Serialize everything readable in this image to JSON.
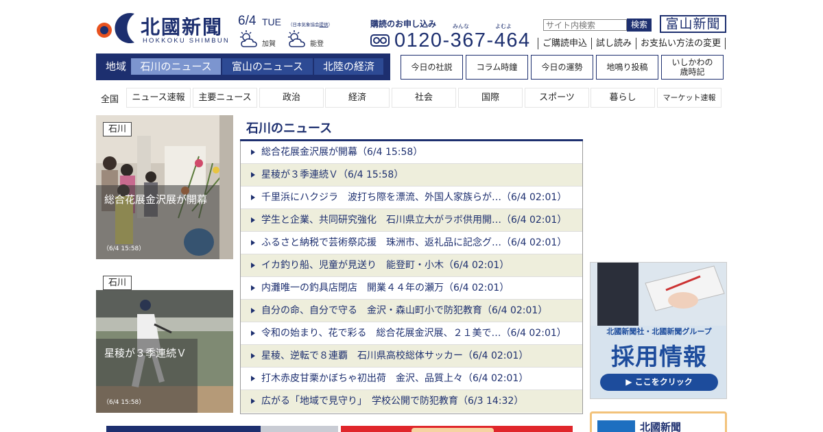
{
  "header": {
    "logo_text": "北國新聞",
    "logo_sub": "HOKKOKU SHIMBUN",
    "date": "6/4",
    "day": "TUE",
    "weather_credit_prefix": "（日本気象協会",
    "weather_credit_link": "提供",
    "weather_credit_suffix": "）",
    "weather": [
      {
        "area": "加賀",
        "icon": "sun-cloud-icon"
      },
      {
        "area": "能登",
        "icon": "sun-cloud-icon"
      }
    ],
    "subscribe_title": "購読のお申し込み",
    "phone_ruby_1": "みんな",
    "phone_ruby_2": "よむよ",
    "phone": "0120-367-464",
    "search_placeholder": "サイト内検索",
    "search_button": "検索",
    "toyama_logo": "富山新聞",
    "sub_links": [
      "ご購読申込",
      "試し読み",
      "お支払い方法の変更"
    ]
  },
  "region_nav": {
    "label": "地域",
    "items": [
      "石川のニュース",
      "富山のニュース",
      "北陸の経済"
    ],
    "active_index": 0
  },
  "feature_buttons": [
    "今日の社説",
    "コラム時鐘",
    "今日の運勢",
    "地鳴り投稿",
    "いしかわの",
    "歳時記"
  ],
  "category_nav": {
    "all_label": "全国",
    "items": [
      "ニュース速報",
      "主要ニュース",
      "政治",
      "経済",
      "社会",
      "国際",
      "スポーツ",
      "暮らし",
      "マーケット速報"
    ]
  },
  "photos": [
    {
      "tag": "石川",
      "title": "総合花展金沢展が開幕",
      "time": "（6/4 15:58）"
    },
    {
      "tag": "石川",
      "title": "星稜が３季連続Ｖ",
      "time": "（6/4 15:58）"
    }
  ],
  "news": {
    "heading": "石川のニュース",
    "items": [
      "総合花展金沢展が開幕（6/4 15:58）",
      "星稜が３季連続Ｖ（6/4 15:58）",
      "千里浜にハクジラ　波打ち際を漂流、外国人家族らが…（6/4 02:01）",
      "学生と企業、共同研究強化　石川県立大がラボ供用開…（6/4 02:01）",
      "ふるさと納税で芸術祭応援　珠洲市、返礼品に記念グ…（6/4 02:01）",
      "イカ釣り船、児童が見送り　能登町・小木（6/4 02:01）",
      "内灘唯一の釣具店閉店　開業４４年の瀬万（6/4 02:01）",
      "自分の命、自分で守る　金沢・森山町小で防犯教育（6/4 02:01）",
      "令和の始まり、花で彩る　総合花展金沢展、２１美で…（6/4 02:01）",
      "星稜、逆転で８連覇　石川県高校総体サッカー（6/4 02:01）",
      "打木赤皮甘栗かぼちゃ初出荷　金沢、品質上々（6/4 02:01）",
      "広がる「地域で見守り」　学校公開で防犯教育（6/3 14:32）"
    ]
  },
  "recruit_banner": {
    "company": "北國新聞社・北國新聞グループ",
    "title": "採用情報",
    "button": "▶ ここをクリック"
  },
  "promo": {
    "text": "北國新聞"
  },
  "colors": {
    "brand_navy": "#1d2f6f",
    "active_tab": "#7c95cf",
    "alt_row": "#eeeedc",
    "recruit_blue": "#1d4c9c"
  }
}
